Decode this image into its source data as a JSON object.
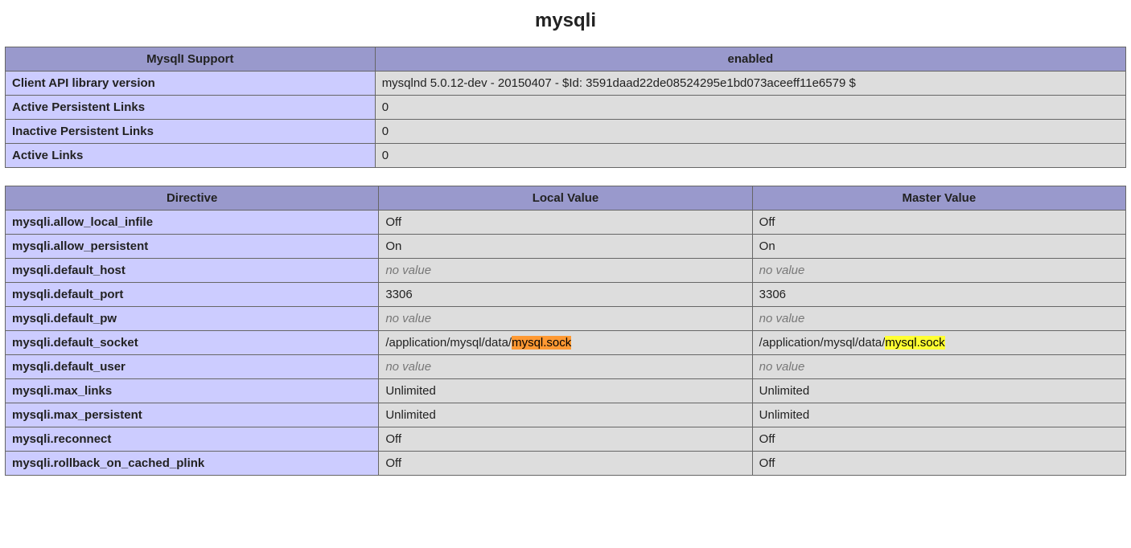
{
  "title": "mysqli",
  "summary": {
    "headers": [
      "MysqlI Support",
      "enabled"
    ],
    "rows": [
      {
        "label": "Client API library version",
        "value": "mysqlnd 5.0.12-dev - 20150407 - $Id: 3591daad22de08524295e1bd073aceeff11e6579 $"
      },
      {
        "label": "Active Persistent Links",
        "value": "0"
      },
      {
        "label": "Inactive Persistent Links",
        "value": "0"
      },
      {
        "label": "Active Links",
        "value": "0"
      }
    ]
  },
  "directives": {
    "headers": [
      "Directive",
      "Local Value",
      "Master Value"
    ],
    "no_value_label": "no value",
    "rows": [
      {
        "name": "mysqli.allow_local_infile",
        "local": "Off",
        "master": "Off"
      },
      {
        "name": "mysqli.allow_persistent",
        "local": "On",
        "master": "On"
      },
      {
        "name": "mysqli.default_host",
        "local": null,
        "master": null
      },
      {
        "name": "mysqli.default_port",
        "local": "3306",
        "master": "3306"
      },
      {
        "name": "mysqli.default_pw",
        "local": null,
        "master": null
      },
      {
        "name": "mysqli.default_socket",
        "local_prefix": "/application/mysql/data/",
        "local_highlight": "mysql.sock",
        "local_hl_class": "hl-orange",
        "master_prefix": "/application/mysql/data/",
        "master_highlight": "mysql.sock",
        "master_hl_class": "hl-yellow"
      },
      {
        "name": "mysqli.default_user",
        "local": null,
        "master": null
      },
      {
        "name": "mysqli.max_links",
        "local": "Unlimited",
        "master": "Unlimited"
      },
      {
        "name": "mysqli.max_persistent",
        "local": "Unlimited",
        "master": "Unlimited"
      },
      {
        "name": "mysqli.reconnect",
        "local": "Off",
        "master": "Off"
      },
      {
        "name": "mysqli.rollback_on_cached_plink",
        "local": "Off",
        "master": "Off"
      }
    ]
  }
}
